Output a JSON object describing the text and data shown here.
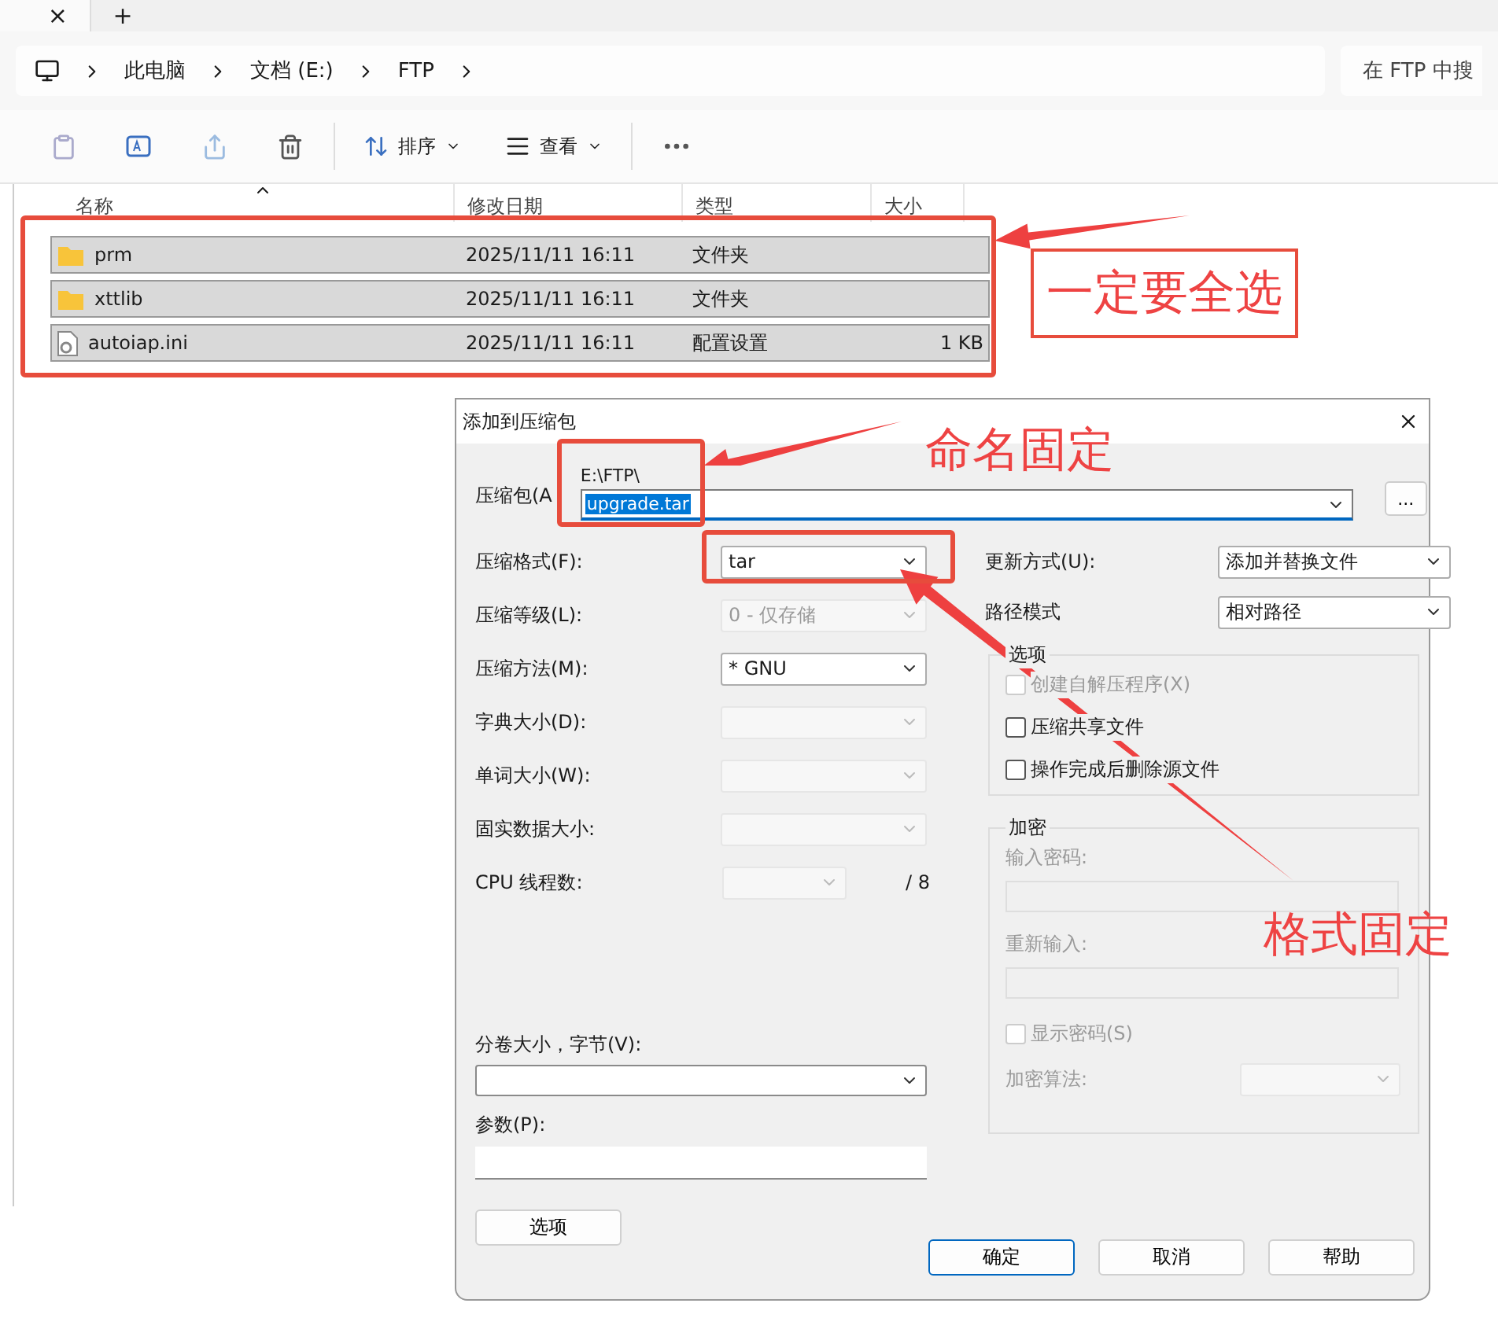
{
  "tab_bar": {
    "close": "×",
    "new_tab": "+"
  },
  "breadcrumb": [
    "此电脑",
    "文档 (E:)",
    "FTP"
  ],
  "search": {
    "placeholder": "在 FTP 中搜"
  },
  "toolbar": {
    "sort": "排序",
    "view": "查看"
  },
  "columns": [
    "名称",
    "修改日期",
    "类型",
    "大小"
  ],
  "files": [
    {
      "name": "prm",
      "kind": "folder",
      "modified": "2025/11/11 16:11",
      "type": "文件夹",
      "selected": true
    },
    {
      "name": "xttlib",
      "kind": "folder",
      "modified": "2025/11/11 16:11",
      "type": "文件夹",
      "selected": true
    },
    {
      "name": "autoiap.ini",
      "kind": "settings",
      "modified": "2025/11/11 16:11",
      "type": "配置设置",
      "size": "1 KB",
      "selected": true
    }
  ],
  "dialog": {
    "title": "添加到压缩包",
    "archive_label": "压缩包(A",
    "archive_path": "E:\\FTP\\",
    "archive_name": "upgrade.tar",
    "browse": "...",
    "left_fields": [
      {
        "label": "压缩格式(F):",
        "value": "tar",
        "disabled": false
      },
      {
        "label": "压缩等级(L):",
        "value": "0 - 仅存储",
        "disabled": true
      },
      {
        "label": "压缩方法(M):",
        "value": "* GNU",
        "disabled": false
      },
      {
        "label": "字典大小(D):",
        "disabled": true
      },
      {
        "label": "单词大小(W):",
        "disabled": true
      },
      {
        "label": "固实数据大小:",
        "disabled": true
      }
    ],
    "cpu": {
      "label": "CPU 线程数:",
      "total": "/ 8",
      "disabled": true
    },
    "volume_label": "分卷大小，字节(V):",
    "params_label": "参数(P):",
    "options_button": "选项",
    "right_fields": [
      {
        "label": "更新方式(U):",
        "value": "添加并替换文件"
      },
      {
        "label": "路径模式",
        "value": "相对路径"
      }
    ],
    "options_group": {
      "title": "选项",
      "checks": [
        {
          "label": "创建自解压程序(X)",
          "checked": false,
          "disabled": true
        },
        {
          "label": "压缩共享文件",
          "checked": false,
          "disabled": false
        },
        {
          "label": "操作完成后删除源文件",
          "checked": false,
          "disabled": false
        }
      ]
    },
    "encryption": {
      "title": "加密",
      "password_label": "输入密码:",
      "reenter_label": "重新输入:",
      "show_password": {
        "label": "显示密码(S)",
        "checked": false,
        "disabled": true
      },
      "method_label": "加密算法:",
      "disabled": true
    },
    "buttons": [
      {
        "label": "确定",
        "default": true
      },
      {
        "label": "取消",
        "default": false
      },
      {
        "label": "帮助",
        "default": false
      }
    ]
  },
  "annotations": [
    {
      "text": "一定要全选",
      "kind": "boxed"
    },
    {
      "text": "命名固定",
      "kind": "plain"
    },
    {
      "text": "格式固定",
      "kind": "plain"
    }
  ]
}
